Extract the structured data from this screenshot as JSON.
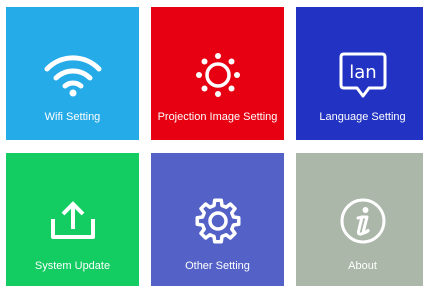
{
  "tiles": [
    {
      "label": "Wifi Setting",
      "icon": "wifi-icon",
      "color": "#26ABE9"
    },
    {
      "label": "Projection Image Setting",
      "icon": "sun-icon",
      "color": "#E60012"
    },
    {
      "label": "Language Setting",
      "icon": "language-icon",
      "icon_text": "lan",
      "color": "#2233C4"
    },
    {
      "label": "System Update",
      "icon": "upload-icon",
      "color": "#13CC62"
    },
    {
      "label": "Other Setting",
      "icon": "gear-icon",
      "color": "#5462C7"
    },
    {
      "label": "About",
      "icon": "info-icon",
      "color": "#AAB7A9"
    }
  ]
}
